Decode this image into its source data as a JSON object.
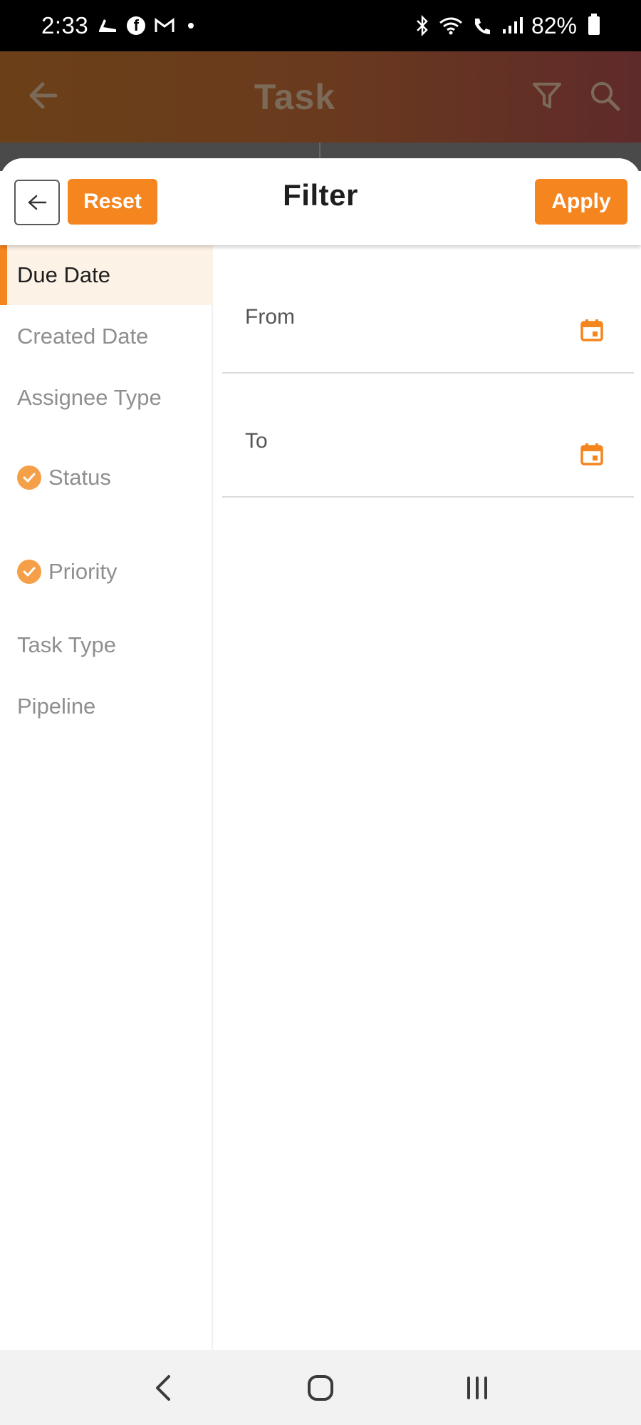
{
  "status_bar": {
    "time": "2:33",
    "battery": "82%",
    "icons": [
      "shoe-icon",
      "facebook-icon",
      "gmail-icon",
      "dot-icon",
      "bluetooth-icon",
      "wifi-icon",
      "call-icon",
      "signal-icon",
      "battery-icon"
    ],
    "facebook_glyph": "f"
  },
  "app_bar": {
    "title": "Task"
  },
  "sheet": {
    "title": "Filter",
    "reset_label": "Reset",
    "apply_label": "Apply"
  },
  "menu": {
    "items": [
      {
        "label": "Due Date",
        "active": true,
        "checked": false
      },
      {
        "label": "Created Date",
        "active": false,
        "checked": false
      },
      {
        "label": "Assignee Type",
        "active": false,
        "checked": false
      },
      {
        "label": "Status",
        "active": false,
        "checked": true
      },
      {
        "label": "Priority",
        "active": false,
        "checked": true
      },
      {
        "label": "Task Type",
        "active": false,
        "checked": false
      },
      {
        "label": "Pipeline",
        "active": false,
        "checked": false
      }
    ]
  },
  "fields": {
    "from_label": "From",
    "to_label": "To"
  },
  "colors": {
    "accent": "#f5851f",
    "check": "#f5a049",
    "active_bg": "#fdf2e6"
  }
}
